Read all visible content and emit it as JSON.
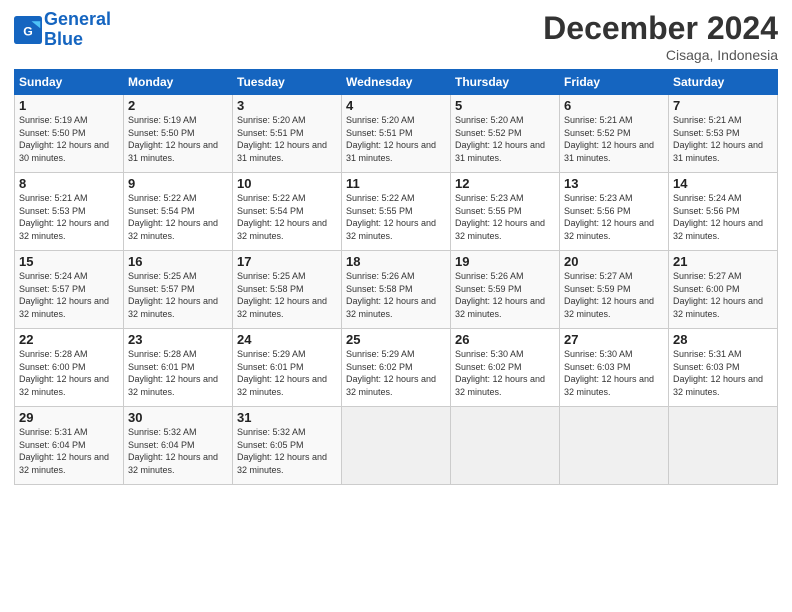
{
  "logo": {
    "line1": "General",
    "line2": "Blue"
  },
  "title": "December 2024",
  "subtitle": "Cisaga, Indonesia",
  "weekdays": [
    "Sunday",
    "Monday",
    "Tuesday",
    "Wednesday",
    "Thursday",
    "Friday",
    "Saturday"
  ],
  "weeks": [
    [
      {
        "day": 1,
        "rise": "5:19 AM",
        "set": "5:50 PM",
        "daylight": "12 hours and 30 minutes."
      },
      {
        "day": 2,
        "rise": "5:19 AM",
        "set": "5:50 PM",
        "daylight": "12 hours and 31 minutes."
      },
      {
        "day": 3,
        "rise": "5:20 AM",
        "set": "5:51 PM",
        "daylight": "12 hours and 31 minutes."
      },
      {
        "day": 4,
        "rise": "5:20 AM",
        "set": "5:51 PM",
        "daylight": "12 hours and 31 minutes."
      },
      {
        "day": 5,
        "rise": "5:20 AM",
        "set": "5:52 PM",
        "daylight": "12 hours and 31 minutes."
      },
      {
        "day": 6,
        "rise": "5:21 AM",
        "set": "5:52 PM",
        "daylight": "12 hours and 31 minutes."
      },
      {
        "day": 7,
        "rise": "5:21 AM",
        "set": "5:53 PM",
        "daylight": "12 hours and 31 minutes."
      }
    ],
    [
      {
        "day": 8,
        "rise": "5:21 AM",
        "set": "5:53 PM",
        "daylight": "12 hours and 32 minutes."
      },
      {
        "day": 9,
        "rise": "5:22 AM",
        "set": "5:54 PM",
        "daylight": "12 hours and 32 minutes."
      },
      {
        "day": 10,
        "rise": "5:22 AM",
        "set": "5:54 PM",
        "daylight": "12 hours and 32 minutes."
      },
      {
        "day": 11,
        "rise": "5:22 AM",
        "set": "5:55 PM",
        "daylight": "12 hours and 32 minutes."
      },
      {
        "day": 12,
        "rise": "5:23 AM",
        "set": "5:55 PM",
        "daylight": "12 hours and 32 minutes."
      },
      {
        "day": 13,
        "rise": "5:23 AM",
        "set": "5:56 PM",
        "daylight": "12 hours and 32 minutes."
      },
      {
        "day": 14,
        "rise": "5:24 AM",
        "set": "5:56 PM",
        "daylight": "12 hours and 32 minutes."
      }
    ],
    [
      {
        "day": 15,
        "rise": "5:24 AM",
        "set": "5:57 PM",
        "daylight": "12 hours and 32 minutes."
      },
      {
        "day": 16,
        "rise": "5:25 AM",
        "set": "5:57 PM",
        "daylight": "12 hours and 32 minutes."
      },
      {
        "day": 17,
        "rise": "5:25 AM",
        "set": "5:58 PM",
        "daylight": "12 hours and 32 minutes."
      },
      {
        "day": 18,
        "rise": "5:26 AM",
        "set": "5:58 PM",
        "daylight": "12 hours and 32 minutes."
      },
      {
        "day": 19,
        "rise": "5:26 AM",
        "set": "5:59 PM",
        "daylight": "12 hours and 32 minutes."
      },
      {
        "day": 20,
        "rise": "5:27 AM",
        "set": "5:59 PM",
        "daylight": "12 hours and 32 minutes."
      },
      {
        "day": 21,
        "rise": "5:27 AM",
        "set": "6:00 PM",
        "daylight": "12 hours and 32 minutes."
      }
    ],
    [
      {
        "day": 22,
        "rise": "5:28 AM",
        "set": "6:00 PM",
        "daylight": "12 hours and 32 minutes."
      },
      {
        "day": 23,
        "rise": "5:28 AM",
        "set": "6:01 PM",
        "daylight": "12 hours and 32 minutes."
      },
      {
        "day": 24,
        "rise": "5:29 AM",
        "set": "6:01 PM",
        "daylight": "12 hours and 32 minutes."
      },
      {
        "day": 25,
        "rise": "5:29 AM",
        "set": "6:02 PM",
        "daylight": "12 hours and 32 minutes."
      },
      {
        "day": 26,
        "rise": "5:30 AM",
        "set": "6:02 PM",
        "daylight": "12 hours and 32 minutes."
      },
      {
        "day": 27,
        "rise": "5:30 AM",
        "set": "6:03 PM",
        "daylight": "12 hours and 32 minutes."
      },
      {
        "day": 28,
        "rise": "5:31 AM",
        "set": "6:03 PM",
        "daylight": "12 hours and 32 minutes."
      }
    ],
    [
      {
        "day": 29,
        "rise": "5:31 AM",
        "set": "6:04 PM",
        "daylight": "12 hours and 32 minutes."
      },
      {
        "day": 30,
        "rise": "5:32 AM",
        "set": "6:04 PM",
        "daylight": "12 hours and 32 minutes."
      },
      {
        "day": 31,
        "rise": "5:32 AM",
        "set": "6:05 PM",
        "daylight": "12 hours and 32 minutes."
      },
      null,
      null,
      null,
      null
    ]
  ]
}
